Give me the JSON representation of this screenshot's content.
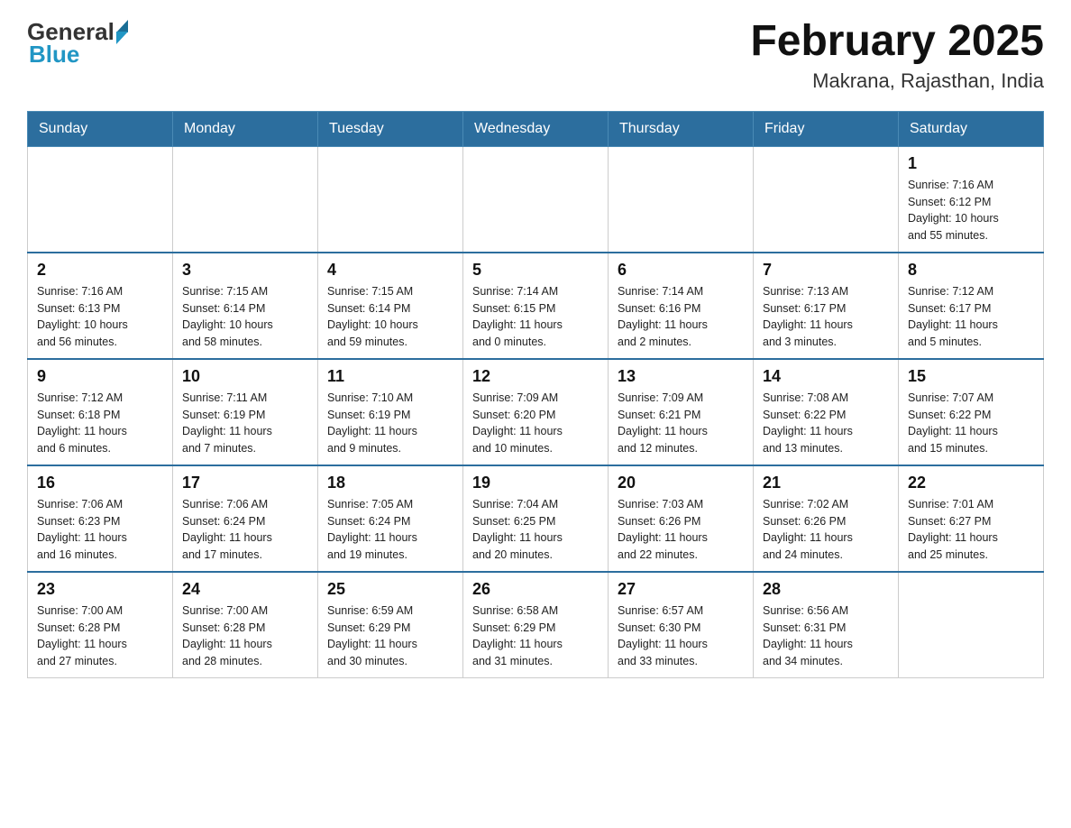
{
  "header": {
    "logo_general": "General",
    "logo_blue": "Blue",
    "title": "February 2025",
    "location": "Makrana, Rajasthan, India"
  },
  "days_of_week": [
    "Sunday",
    "Monday",
    "Tuesday",
    "Wednesday",
    "Thursday",
    "Friday",
    "Saturday"
  ],
  "weeks": [
    [
      {
        "day": "",
        "info": ""
      },
      {
        "day": "",
        "info": ""
      },
      {
        "day": "",
        "info": ""
      },
      {
        "day": "",
        "info": ""
      },
      {
        "day": "",
        "info": ""
      },
      {
        "day": "",
        "info": ""
      },
      {
        "day": "1",
        "info": "Sunrise: 7:16 AM\nSunset: 6:12 PM\nDaylight: 10 hours\nand 55 minutes."
      }
    ],
    [
      {
        "day": "2",
        "info": "Sunrise: 7:16 AM\nSunset: 6:13 PM\nDaylight: 10 hours\nand 56 minutes."
      },
      {
        "day": "3",
        "info": "Sunrise: 7:15 AM\nSunset: 6:14 PM\nDaylight: 10 hours\nand 58 minutes."
      },
      {
        "day": "4",
        "info": "Sunrise: 7:15 AM\nSunset: 6:14 PM\nDaylight: 10 hours\nand 59 minutes."
      },
      {
        "day": "5",
        "info": "Sunrise: 7:14 AM\nSunset: 6:15 PM\nDaylight: 11 hours\nand 0 minutes."
      },
      {
        "day": "6",
        "info": "Sunrise: 7:14 AM\nSunset: 6:16 PM\nDaylight: 11 hours\nand 2 minutes."
      },
      {
        "day": "7",
        "info": "Sunrise: 7:13 AM\nSunset: 6:17 PM\nDaylight: 11 hours\nand 3 minutes."
      },
      {
        "day": "8",
        "info": "Sunrise: 7:12 AM\nSunset: 6:17 PM\nDaylight: 11 hours\nand 5 minutes."
      }
    ],
    [
      {
        "day": "9",
        "info": "Sunrise: 7:12 AM\nSunset: 6:18 PM\nDaylight: 11 hours\nand 6 minutes."
      },
      {
        "day": "10",
        "info": "Sunrise: 7:11 AM\nSunset: 6:19 PM\nDaylight: 11 hours\nand 7 minutes."
      },
      {
        "day": "11",
        "info": "Sunrise: 7:10 AM\nSunset: 6:19 PM\nDaylight: 11 hours\nand 9 minutes."
      },
      {
        "day": "12",
        "info": "Sunrise: 7:09 AM\nSunset: 6:20 PM\nDaylight: 11 hours\nand 10 minutes."
      },
      {
        "day": "13",
        "info": "Sunrise: 7:09 AM\nSunset: 6:21 PM\nDaylight: 11 hours\nand 12 minutes."
      },
      {
        "day": "14",
        "info": "Sunrise: 7:08 AM\nSunset: 6:22 PM\nDaylight: 11 hours\nand 13 minutes."
      },
      {
        "day": "15",
        "info": "Sunrise: 7:07 AM\nSunset: 6:22 PM\nDaylight: 11 hours\nand 15 minutes."
      }
    ],
    [
      {
        "day": "16",
        "info": "Sunrise: 7:06 AM\nSunset: 6:23 PM\nDaylight: 11 hours\nand 16 minutes."
      },
      {
        "day": "17",
        "info": "Sunrise: 7:06 AM\nSunset: 6:24 PM\nDaylight: 11 hours\nand 17 minutes."
      },
      {
        "day": "18",
        "info": "Sunrise: 7:05 AM\nSunset: 6:24 PM\nDaylight: 11 hours\nand 19 minutes."
      },
      {
        "day": "19",
        "info": "Sunrise: 7:04 AM\nSunset: 6:25 PM\nDaylight: 11 hours\nand 20 minutes."
      },
      {
        "day": "20",
        "info": "Sunrise: 7:03 AM\nSunset: 6:26 PM\nDaylight: 11 hours\nand 22 minutes."
      },
      {
        "day": "21",
        "info": "Sunrise: 7:02 AM\nSunset: 6:26 PM\nDaylight: 11 hours\nand 24 minutes."
      },
      {
        "day": "22",
        "info": "Sunrise: 7:01 AM\nSunset: 6:27 PM\nDaylight: 11 hours\nand 25 minutes."
      }
    ],
    [
      {
        "day": "23",
        "info": "Sunrise: 7:00 AM\nSunset: 6:28 PM\nDaylight: 11 hours\nand 27 minutes."
      },
      {
        "day": "24",
        "info": "Sunrise: 7:00 AM\nSunset: 6:28 PM\nDaylight: 11 hours\nand 28 minutes."
      },
      {
        "day": "25",
        "info": "Sunrise: 6:59 AM\nSunset: 6:29 PM\nDaylight: 11 hours\nand 30 minutes."
      },
      {
        "day": "26",
        "info": "Sunrise: 6:58 AM\nSunset: 6:29 PM\nDaylight: 11 hours\nand 31 minutes."
      },
      {
        "day": "27",
        "info": "Sunrise: 6:57 AM\nSunset: 6:30 PM\nDaylight: 11 hours\nand 33 minutes."
      },
      {
        "day": "28",
        "info": "Sunrise: 6:56 AM\nSunset: 6:31 PM\nDaylight: 11 hours\nand 34 minutes."
      },
      {
        "day": "",
        "info": ""
      }
    ]
  ]
}
